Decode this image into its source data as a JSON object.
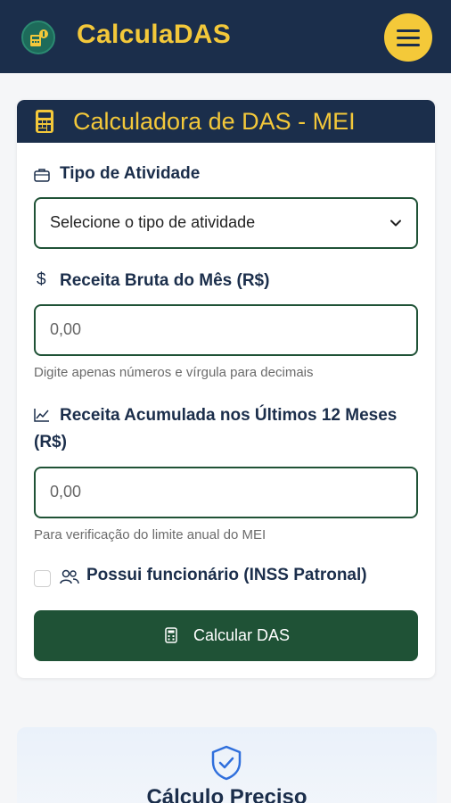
{
  "app": {
    "brand": "CalculaDAS",
    "colors": {
      "navy": "#1b2e4b",
      "gold": "#f3c83a",
      "green": "#1f5236"
    },
    "icons": {
      "logo": "calculator-money-icon",
      "menu": "hamburger-icon"
    }
  },
  "form": {
    "title": "Calculadora de DAS - MEI",
    "activity": {
      "label": "Tipo de Atividade",
      "selected": "Selecione o tipo de atividade"
    },
    "monthly_revenue": {
      "label": "Receita Bruta do Mês (R$)",
      "placeholder": "0,00",
      "hint": "Digite apenas números e vírgula para decimais"
    },
    "accumulated_revenue": {
      "label_line1": "Receita Acumulada nos Últimos 12 Meses",
      "label_line2": "(R$)",
      "placeholder": "0,00",
      "hint": "Para verificação do limite anual do MEI"
    },
    "employee": {
      "label": "Possui funcionário (INSS Patronal)",
      "checked": false
    },
    "submit_label": "Calcular DAS"
  },
  "feature": {
    "title": "Cálculo Preciso"
  }
}
